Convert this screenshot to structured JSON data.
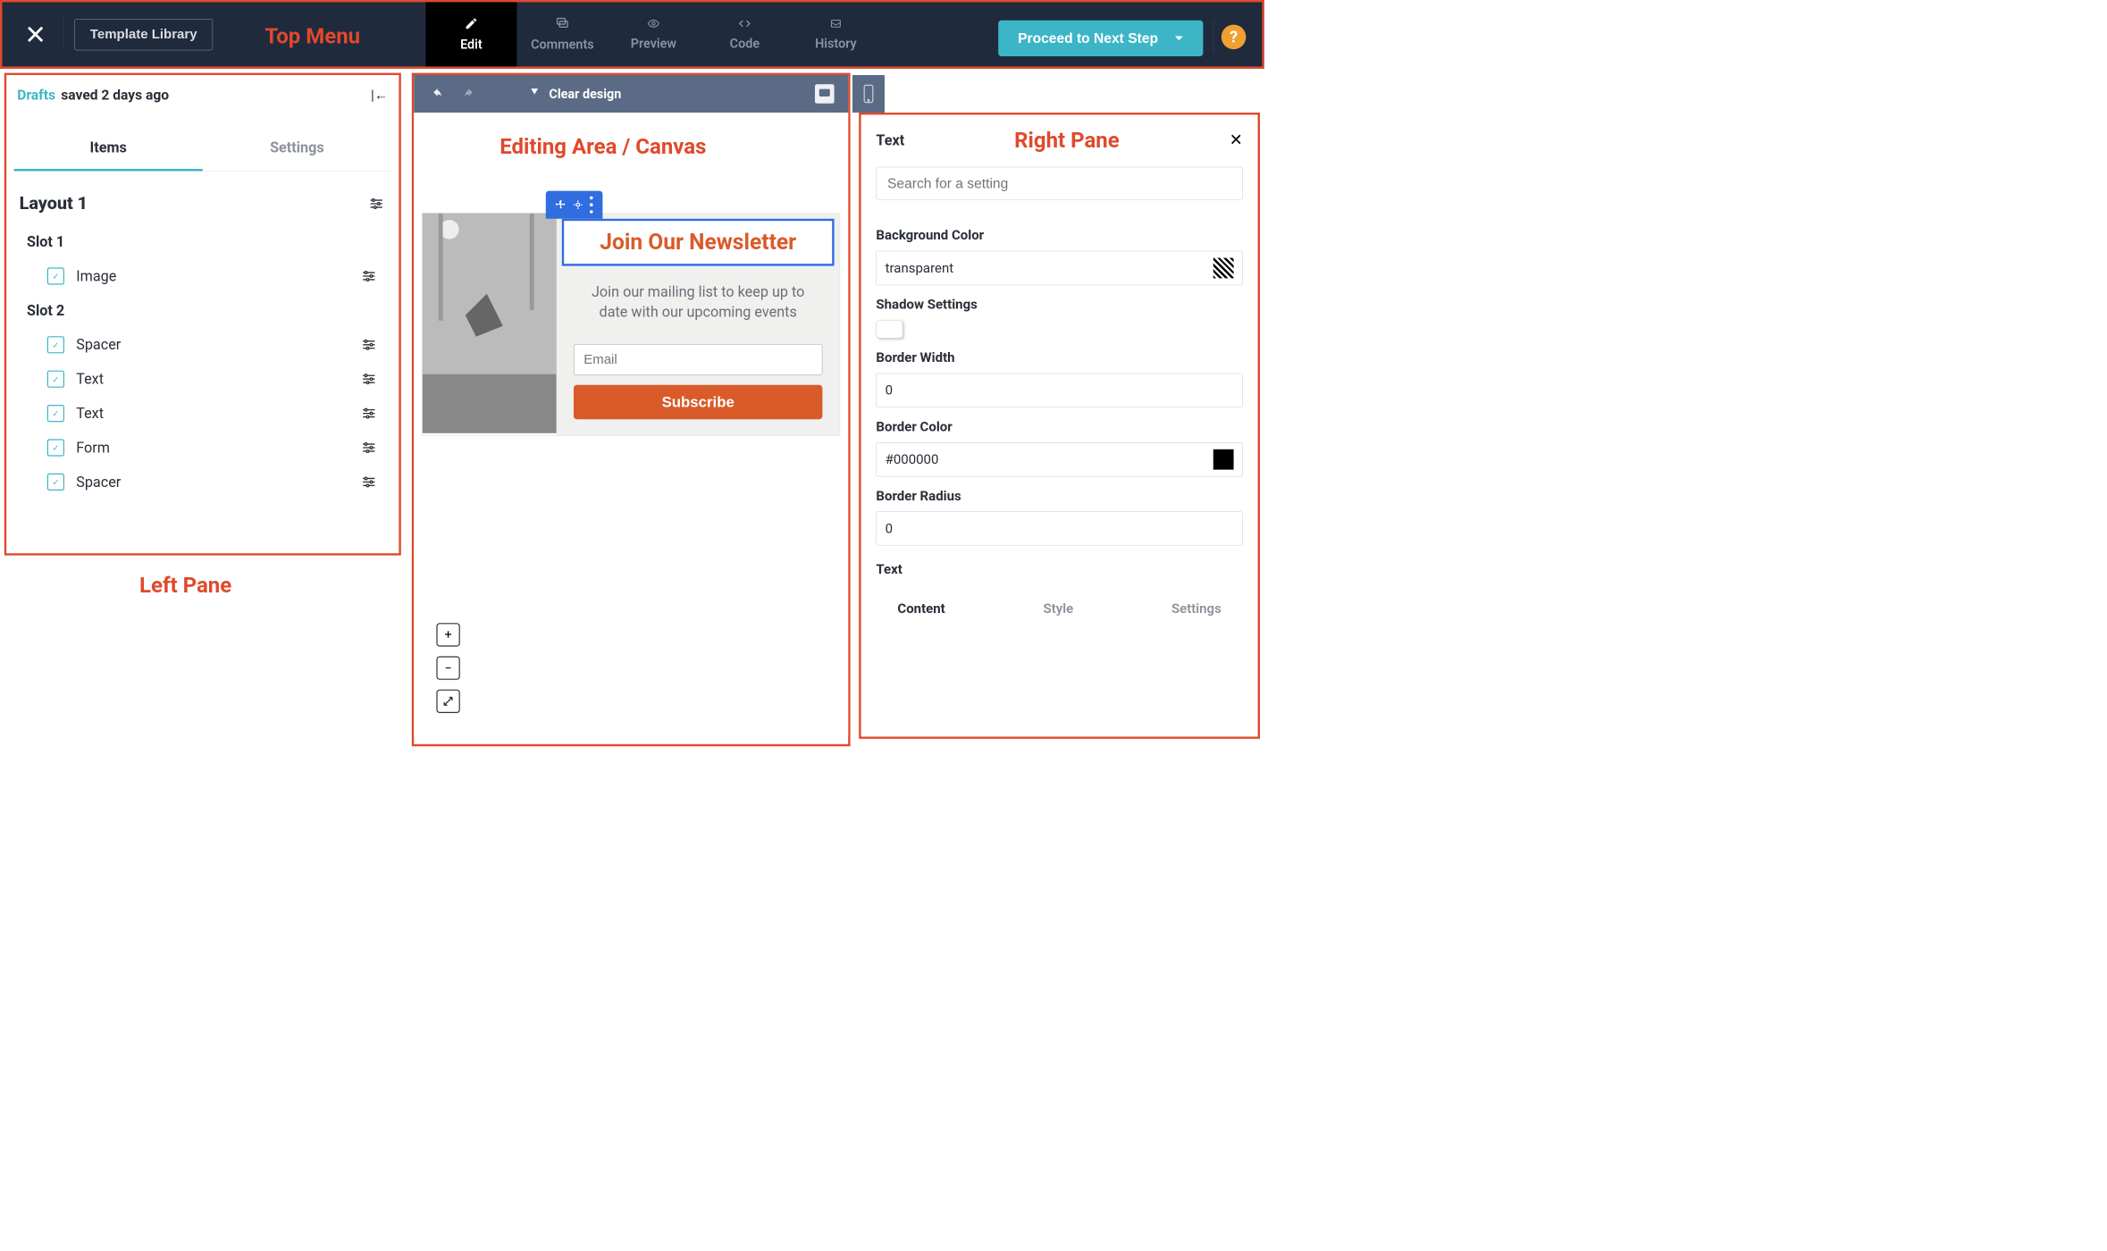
{
  "topbar": {
    "template_library": "Template Library",
    "tabs": [
      {
        "id": "edit",
        "label": "Edit",
        "active": true
      },
      {
        "id": "comments",
        "label": "Comments",
        "active": false
      },
      {
        "id": "preview",
        "label": "Preview",
        "active": false
      },
      {
        "id": "code",
        "label": "Code",
        "active": false
      },
      {
        "id": "history",
        "label": "History",
        "active": false
      }
    ],
    "proceed": "Proceed to Next Step",
    "help": "?"
  },
  "annotations": {
    "top": "Top Menu",
    "left": "Left Pane",
    "canvas": "Editing Area / Canvas",
    "right": "Right Pane"
  },
  "left": {
    "drafts_link": "Drafts",
    "saved_text": "saved 2 days ago",
    "tabs": [
      {
        "label": "Items",
        "active": true
      },
      {
        "label": "Settings",
        "active": false
      }
    ],
    "layout_title": "Layout 1",
    "slots": [
      {
        "title": "Slot 1",
        "items": [
          {
            "label": "Image"
          }
        ]
      },
      {
        "title": "Slot 2",
        "items": [
          {
            "label": "Spacer"
          },
          {
            "label": "Text"
          },
          {
            "label": "Text"
          },
          {
            "label": "Form"
          },
          {
            "label": "Spacer"
          }
        ]
      }
    ]
  },
  "canvas": {
    "clear": "Clear design",
    "newsletter_title": "Join Our Newsletter",
    "newsletter_sub": "Join our mailing list to keep up to date with our upcoming events",
    "email_placeholder": "Email",
    "subscribe": "Subscribe",
    "zoom": {
      "plus": "+",
      "minus": "−"
    }
  },
  "right": {
    "title": "Text",
    "search_placeholder": "Search for a setting",
    "fields": {
      "bg_label": "Background Color",
      "bg_value": "transparent",
      "shadow_label": "Shadow Settings",
      "bw_label": "Border Width",
      "bw_value": "0",
      "bc_label": "Border Color",
      "bc_value": "#000000",
      "br_label": "Border Radius",
      "br_value": "0",
      "text2": "Text"
    },
    "subtabs": {
      "content": "Content",
      "style": "Style",
      "settings": "Settings"
    }
  }
}
